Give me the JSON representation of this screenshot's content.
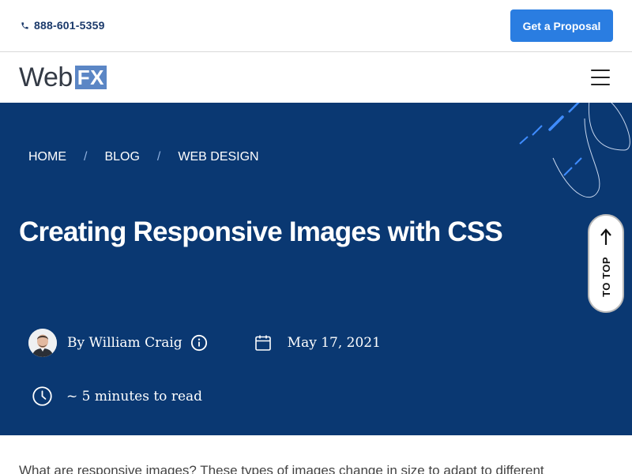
{
  "topbar": {
    "phone": "888-601-5359",
    "cta_label": "Get a Proposal",
    "accent_color": "#2a7de1"
  },
  "nav": {
    "logo_text": "Web",
    "logo_badge": "FX",
    "menu_icon": "hamburger-menu-icon"
  },
  "hero": {
    "background_color": "#0a3872",
    "breadcrumb": [
      "HOME",
      "BLOG",
      "WEB DESIGN"
    ],
    "breadcrumb_separator": "/",
    "title": "Creating Responsive Images with CSS",
    "author": "By William Craig",
    "date": "May 17, 2021",
    "read_time": "~ 5 minutes to read"
  },
  "to_top": {
    "label": "TO TOP"
  },
  "article": {
    "intro": "What are responsive images? These types of images change in size to adapt to different"
  }
}
